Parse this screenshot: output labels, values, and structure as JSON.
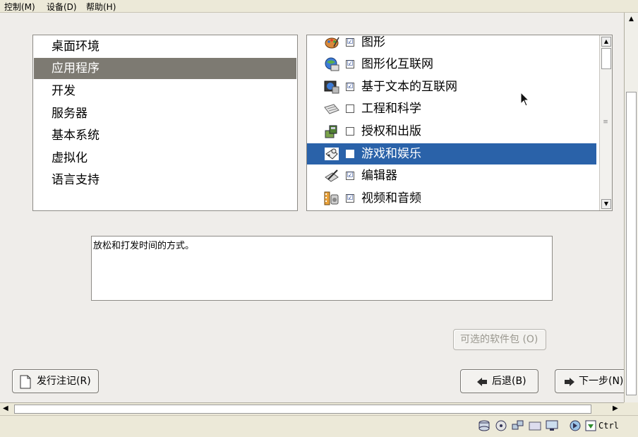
{
  "menubar": {
    "items": [
      "控制(M)",
      "设备(D)",
      "帮助(H)"
    ]
  },
  "categories": {
    "items": [
      "桌面环境",
      "应用程序",
      "开发",
      "服务器",
      "基本系统",
      "虚拟化",
      "语言支持"
    ],
    "selected": "应用程序"
  },
  "packages": {
    "items": [
      {
        "label": "图形",
        "checked": true,
        "icon": "graphics-palette-icon"
      },
      {
        "label": "图形化互联网",
        "checked": true,
        "icon": "graphical-internet-icon"
      },
      {
        "label": "基于文本的互联网",
        "checked": true,
        "icon": "text-internet-icon"
      },
      {
        "label": "工程和科学",
        "checked": false,
        "icon": "engineering-science-icon"
      },
      {
        "label": "授权和出版",
        "checked": false,
        "icon": "authoring-publishing-icon"
      },
      {
        "label": "游戏和娱乐",
        "checked": false,
        "icon": "games-entertainment-icon"
      },
      {
        "label": "编辑器",
        "checked": true,
        "icon": "editors-icon"
      },
      {
        "label": "视频和音频",
        "checked": true,
        "icon": "sound-video-icon"
      }
    ],
    "selected": "游戏和娱乐"
  },
  "description": {
    "text": "放松和打发时间的方式。"
  },
  "buttons": {
    "optional_packages": "可选的软件包 (O)",
    "release_notes": "发行注记(R)",
    "back": "后退(B)",
    "next": "下一步(N)"
  },
  "statusbar": {
    "host_key": "Ctrl"
  },
  "colors": {
    "selection_blue": "#2a62a9",
    "selection_gray": "#7d7a72",
    "background": "#efedea"
  }
}
